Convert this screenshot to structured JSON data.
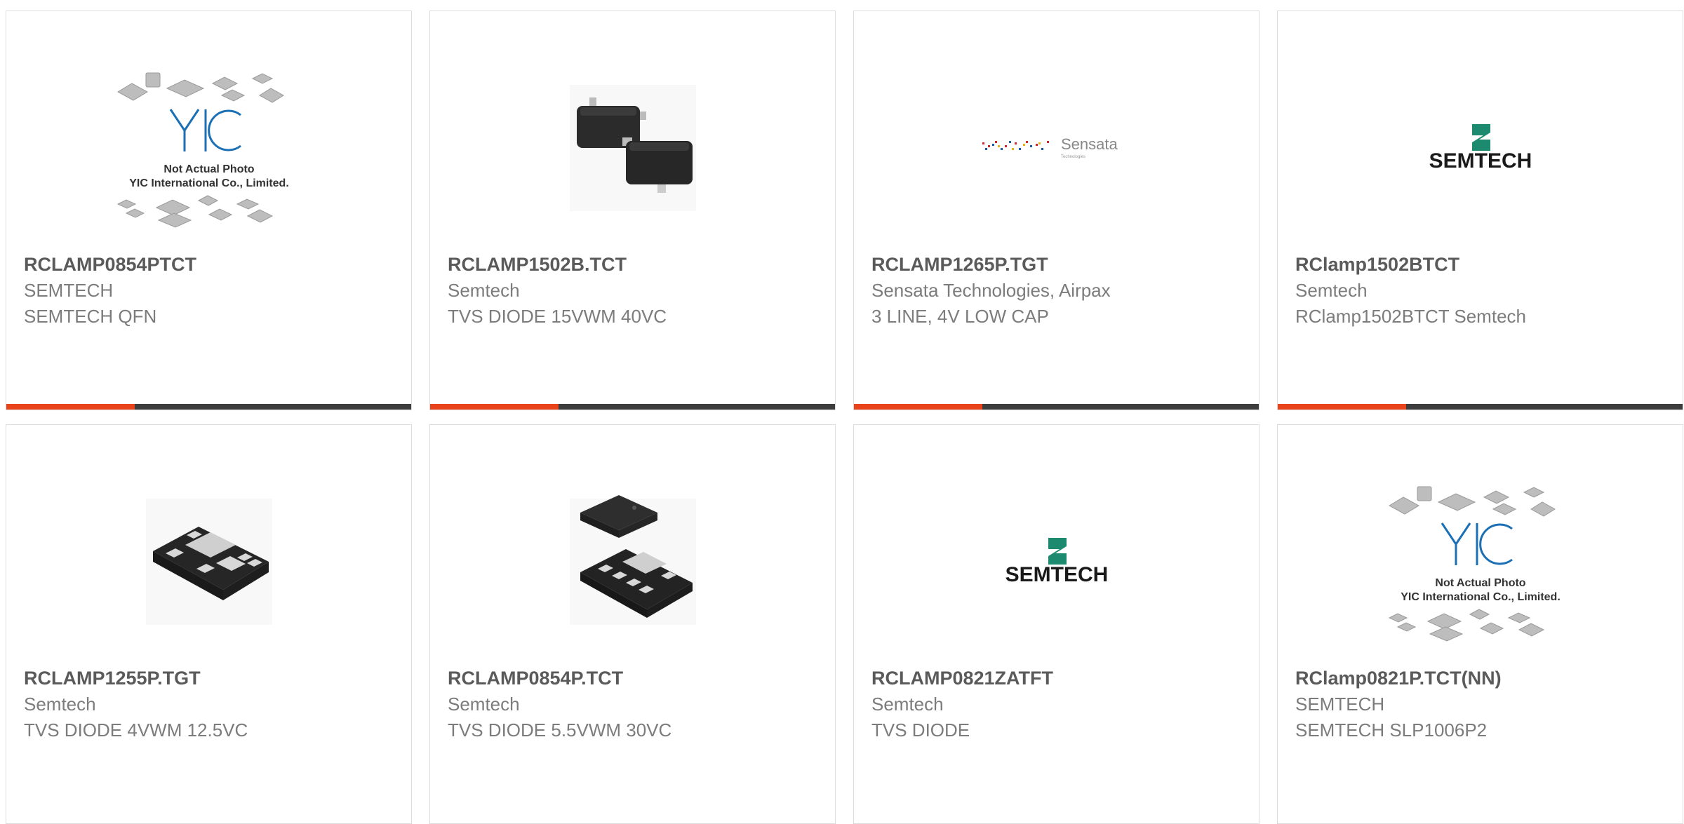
{
  "accent_color": "#e8431a",
  "bar_color": "#3d3d3d",
  "products": [
    {
      "part_number": "RCLAMP0854PTCT",
      "manufacturer": "SEMTECH",
      "description": "SEMTECH QFN",
      "image": "yic-placeholder-image",
      "placeholder_caption": "Not Actual Photo",
      "placeholder_company": "YIC International Co., Limited.",
      "placeholder_logo": "YIC"
    },
    {
      "part_number": "RCLAMP1502B.TCT",
      "manufacturer": "Semtech",
      "description": "TVS DIODE 15VWM 40VC",
      "image": "sot-package-photo"
    },
    {
      "part_number": "RCLAMP1265P.TGT",
      "manufacturer": "Sensata Technologies, Airpax",
      "description": "3 LINE, 4V LOW CAP",
      "image": "sensata-logo",
      "logo_text": "Sensata",
      "logo_subtext": "Technologies"
    },
    {
      "part_number": "RClamp1502BTCT",
      "manufacturer": "Semtech",
      "description": "RClamp1502BTCT Semtech",
      "image": "semtech-logo",
      "logo_text": "SEMTECH"
    },
    {
      "part_number": "RCLAMP1255P.TGT",
      "manufacturer": "Semtech",
      "description": "TVS DIODE 4VWM 12.5VC",
      "image": "slp-package-photo"
    },
    {
      "part_number": "RCLAMP0854P.TCT",
      "manufacturer": "Semtech",
      "description": "TVS DIODE 5.5VWM 30VC",
      "image": "slp-two-package-photo"
    },
    {
      "part_number": "RCLAMP0821ZATFT",
      "manufacturer": "Semtech",
      "description": "TVS DIODE",
      "image": "semtech-logo",
      "logo_text": "SEMTECH"
    },
    {
      "part_number": "RClamp0821P.TCT(NN)",
      "manufacturer": "SEMTECH",
      "description": "SEMTECH SLP1006P2",
      "image": "yic-placeholder-image",
      "placeholder_caption": "Not Actual Photo",
      "placeholder_company": "YIC International Co., Limited.",
      "placeholder_logo": "YIC"
    }
  ]
}
